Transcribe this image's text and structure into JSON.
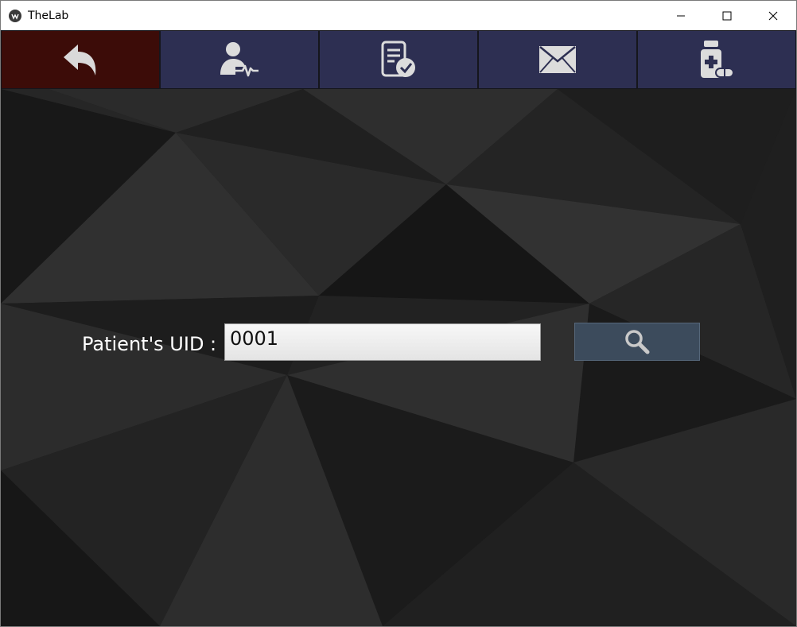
{
  "window": {
    "title": "TheLab",
    "controls": [
      "minimize",
      "maximize",
      "close"
    ]
  },
  "toolbar": {
    "buttons": [
      {
        "name": "back",
        "icon": "back-arrow-icon",
        "color": "#3c0c08"
      },
      {
        "name": "patient",
        "icon": "patient-health-icon",
        "color": "#2d2f52"
      },
      {
        "name": "reports",
        "icon": "report-check-icon",
        "color": "#2d2f52"
      },
      {
        "name": "mail",
        "icon": "mail-icon",
        "color": "#2d2f52"
      },
      {
        "name": "medicine",
        "icon": "medicine-bottle-icon",
        "color": "#2d2f52"
      }
    ]
  },
  "form": {
    "uid_label": "Patient's UID :",
    "uid_value": "0001",
    "search_icon": "search-icon"
  }
}
